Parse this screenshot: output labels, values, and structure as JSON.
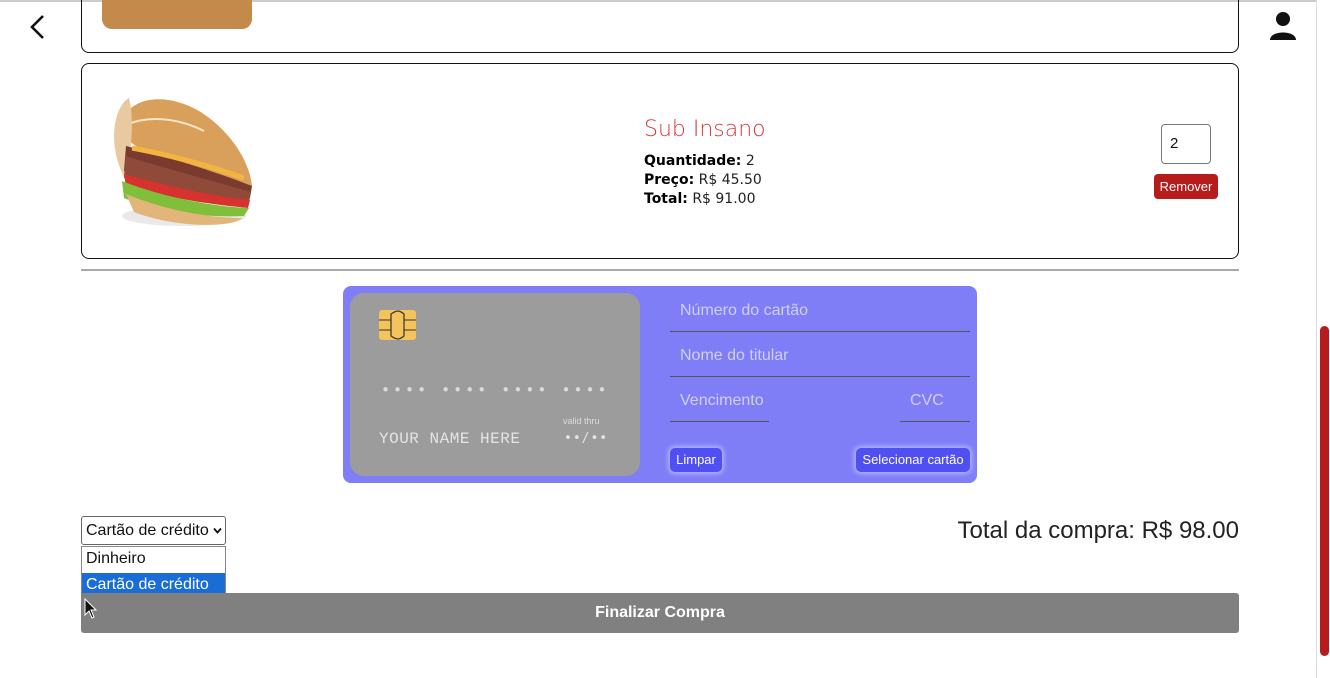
{
  "item": {
    "name": "Sub Insano",
    "qty_label": "Quantidade:",
    "qty_value": "2",
    "price_label": "Preço:",
    "price_value": "R$ 45.50",
    "total_label": "Total:",
    "total_value": "R$ 91.00",
    "qty_input": "2",
    "remove_label": "Remover"
  },
  "card": {
    "number_mask": "•••• •••• •••• ••••",
    "holder_placeholder": "YOUR NAME HERE",
    "valid_thru": "valid thru",
    "expiry_mask": "••/••"
  },
  "form": {
    "number_placeholder": "Número do cartão",
    "name_placeholder": "Nome do titular",
    "expiry_placeholder": "Vencimento",
    "cvc_placeholder": "CVC",
    "clear_label": "Limpar",
    "select_label": "Selecionar cartão"
  },
  "payment": {
    "selected": "Cartão de crédito",
    "options": [
      "Dinheiro",
      "Cartão de crédito"
    ]
  },
  "summary": {
    "total": "Total da compra: R$ 98.00",
    "finalize_label": "Finalizar Compra"
  },
  "colors": {
    "accent": "#b71c1c",
    "card_panel": "#7f7ef7",
    "button_blue": "#4f4ff2",
    "item_title": "#d63a3a"
  },
  "icons": [
    "back-icon",
    "user-icon",
    "chip-icon",
    "chevron-down-icon",
    "cursor-icon"
  ]
}
